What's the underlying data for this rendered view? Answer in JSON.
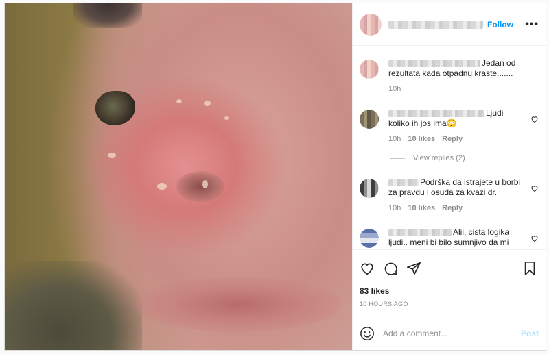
{
  "header": {
    "follow_label": "Follow",
    "more_label": "•••"
  },
  "comments": [
    {
      "text": "Jedan od rezultata kada otpadnu kraste.......",
      "time": "10h"
    },
    {
      "text": "Ljudi koliko ih jos ima😳",
      "time": "10h",
      "likes": "10 likes",
      "reply_label": "Reply",
      "view_replies": "View replies (2)"
    },
    {
      "text": "Podrška da istrajete u borbi za pravdu i osuda za kvazi dr.",
      "time": "10h",
      "likes": "10 likes",
      "reply_label": "Reply"
    },
    {
      "text": "Alii, cista logika ljudi.. meni bi bilo sumnjivo da mi"
    }
  ],
  "likes_count": "83 likes",
  "time_ago": "10 HOURS AGO",
  "add_comment": {
    "placeholder": "Add a comment...",
    "post_label": "Post"
  },
  "colors": {
    "accent": "#0095f6",
    "post_disabled": "#b2dffc",
    "muted": "#8e8e8e"
  },
  "icons": [
    "heart-icon",
    "comment-icon",
    "share-icon",
    "bookmark-icon",
    "emoji-icon",
    "more-options-icon"
  ]
}
